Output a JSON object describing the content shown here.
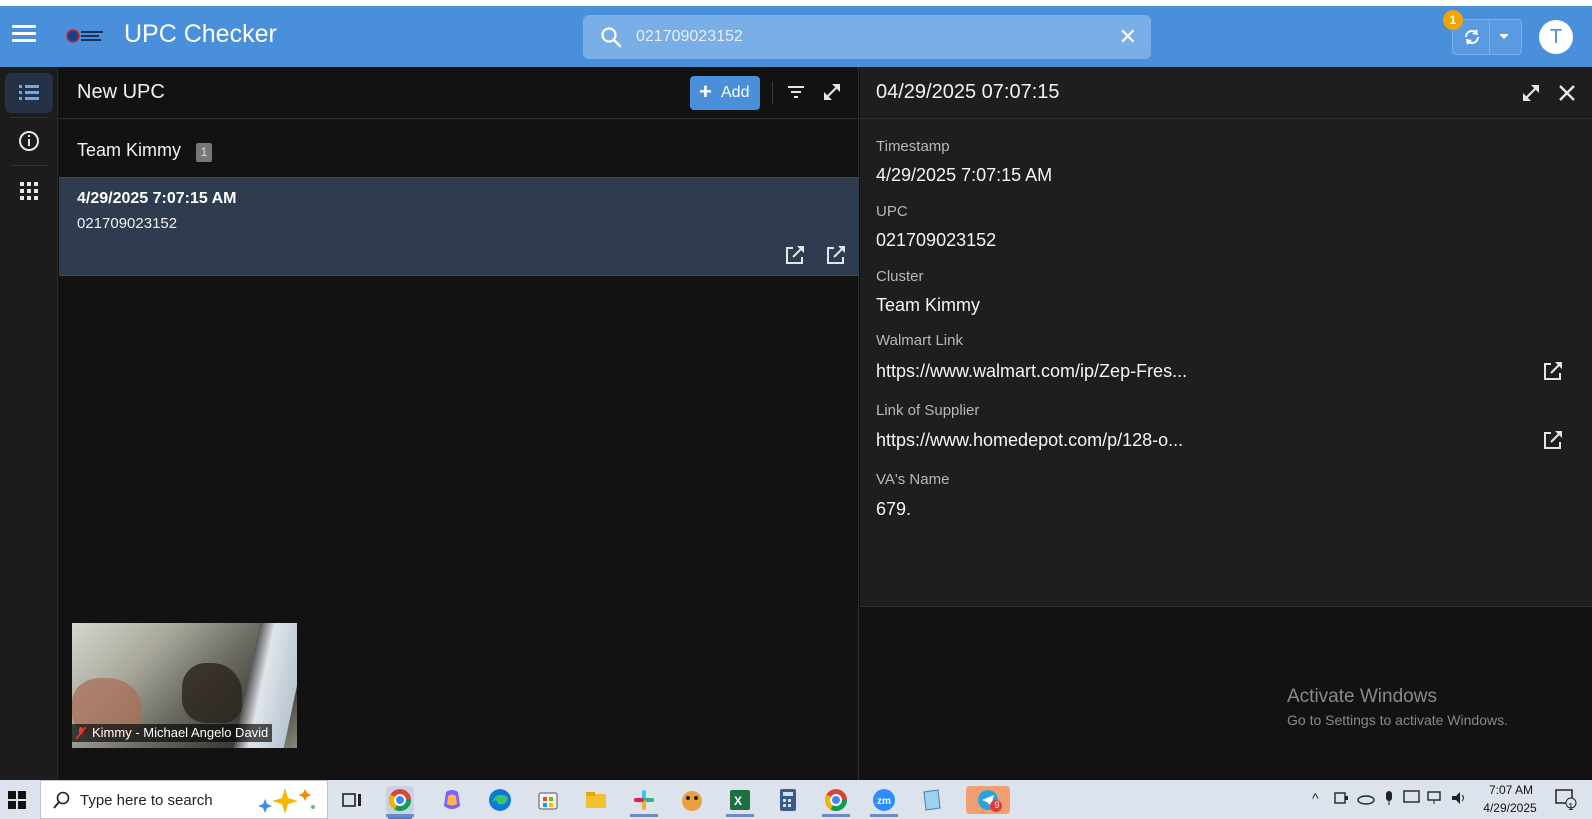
{
  "header": {
    "app_title": "UPC Checker",
    "search_value": "021709023152",
    "notification_count": "1",
    "avatar_initial": "T"
  },
  "list_pane": {
    "title": "New UPC",
    "add_label": "Add",
    "group": {
      "name": "Team Kimmy",
      "count": "1"
    },
    "items": [
      {
        "timestamp": "4/29/2025 7:07:15 AM",
        "upc": "021709023152"
      }
    ]
  },
  "detail": {
    "title": "04/29/2025 07:07:15",
    "fields": [
      {
        "label": "Timestamp",
        "value": "4/29/2025 7:07:15 AM"
      },
      {
        "label": "UPC",
        "value": "021709023152"
      },
      {
        "label": "Cluster",
        "value": "Team Kimmy"
      },
      {
        "label": "Walmart Link",
        "value": "https://www.walmart.com/ip/Zep-Fres..."
      },
      {
        "label": "Link of Supplier",
        "value": "https://www.homedepot.com/p/128-o..."
      },
      {
        "label": "VA's Name",
        "value": "679."
      }
    ]
  },
  "video_overlay": {
    "label": "Kimmy - Michael Angelo David"
  },
  "watermark": {
    "line1": "Activate Windows",
    "line2": "Go to Settings to activate Windows."
  },
  "taskbar": {
    "search_placeholder": "Type here to search",
    "time": "7:07 AM",
    "date": "4/29/2025",
    "notification_count": "1",
    "telegram_badge": "9"
  },
  "colors": {
    "accent": "#4a8fd9",
    "background": "#121212",
    "selected_row": "#2f3b4e",
    "badge": "#f0a500"
  }
}
